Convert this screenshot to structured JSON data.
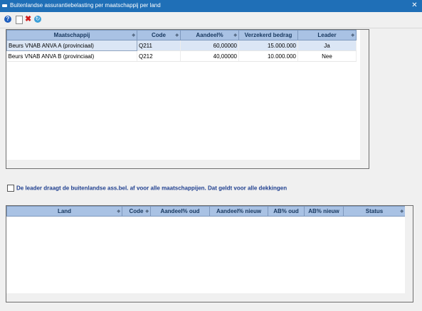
{
  "window": {
    "title": "Buitenlandse assurantiebelasting per maatschappij per land",
    "close_glyph": "✕"
  },
  "toolbar": {
    "help_glyph": "?",
    "delete_glyph": "✖",
    "refresh_glyph": "↻",
    "icons": [
      "help-icon",
      "new-document-icon",
      "delete-icon",
      "refresh-icon"
    ]
  },
  "companies_table": {
    "columns": [
      "Maatschappij",
      "Code",
      "Aandeel%",
      "Verzekerd bedrag",
      "Leader"
    ],
    "rows": [
      {
        "maatschappij": "Beurs VNAB ANVA A (provinciaal)",
        "code": "Q211",
        "aandeel": "60,00000",
        "bedrag": "15.000.000",
        "leader": "Ja"
      },
      {
        "maatschappij": "Beurs VNAB ANVA B (provinciaal)",
        "code": "Q212",
        "aandeel": "40,00000",
        "bedrag": "10.000.000",
        "leader": "Nee"
      }
    ]
  },
  "leader_checkbox": {
    "label": "De leader draagt de buitenlandse ass.bel. af voor alle maatschappijen. Dat geldt voor alle dekkingen",
    "checked": false
  },
  "countries_table": {
    "columns": [
      "Land",
      "Code",
      "Aandeel% oud",
      "Aandeel% nieuw",
      "AB% oud",
      "AB% nieuw",
      "Status"
    ],
    "rows": []
  },
  "colors": {
    "titlebar": "#1f6fb7",
    "header_bg": "#a9c2e4",
    "header_text": "#17375e",
    "selected_row": "#dbe6f5"
  }
}
